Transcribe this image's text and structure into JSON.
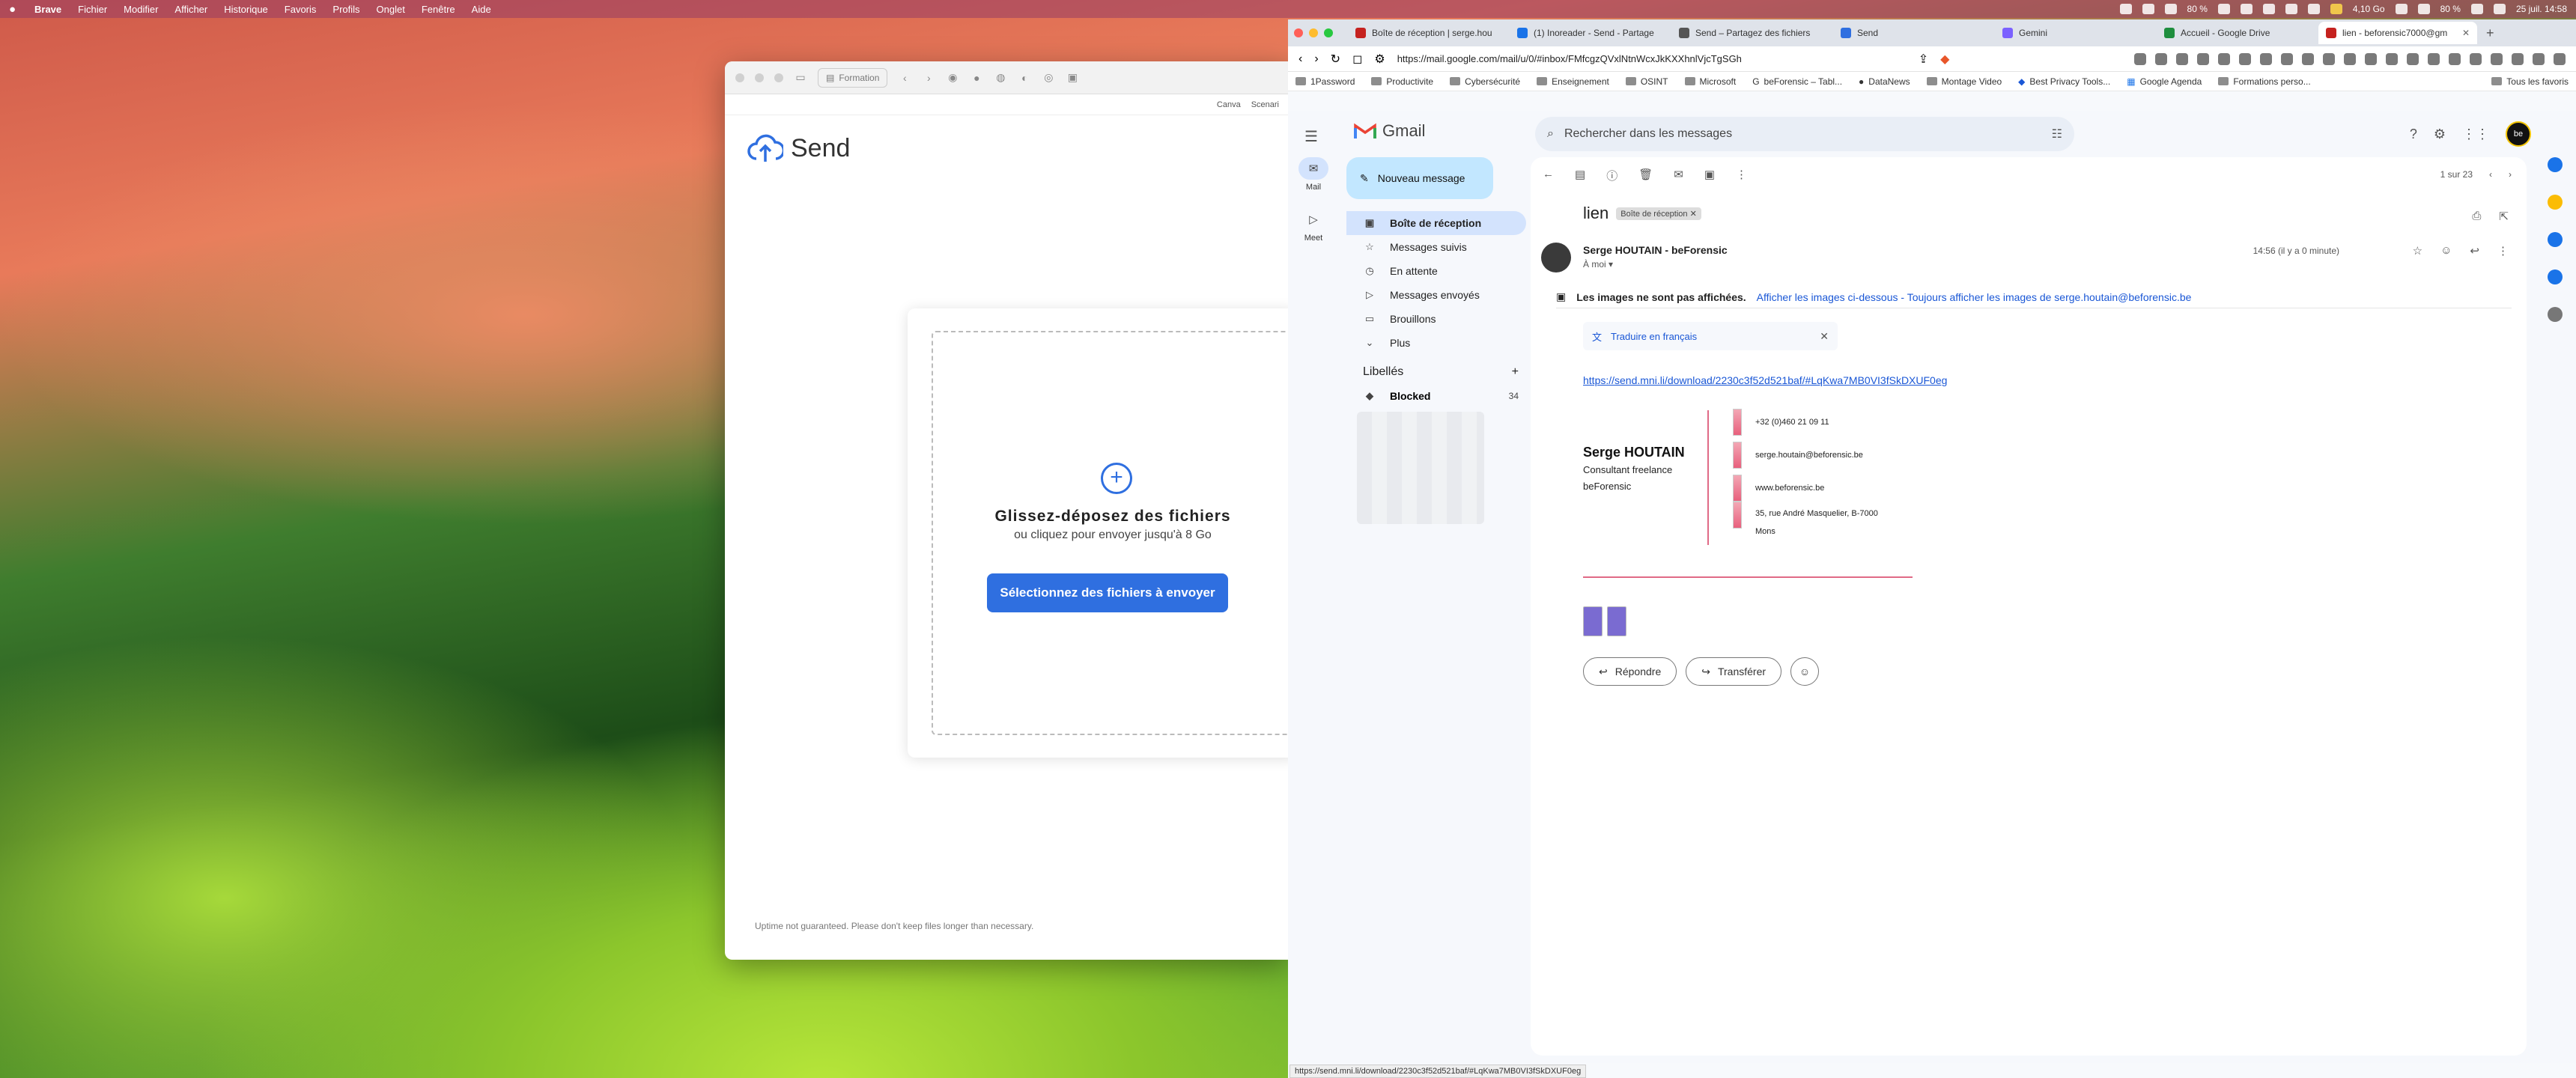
{
  "menubar": {
    "app": "Brave",
    "items": [
      "Fichier",
      "Modifier",
      "Afficher",
      "Historique",
      "Favoris",
      "Profils",
      "Onglet",
      "Fenêtre",
      "Aide"
    ],
    "battery": "80 %",
    "storage": "4,10 Go",
    "battery2": "80 %",
    "datetime": "25 juil. 14:58"
  },
  "send_window": {
    "toolbar_pill": "Formation",
    "bookmarks": [
      "Canva",
      "Scenari"
    ],
    "logo_text": "Send",
    "drop_title": "Glissez-déposez des fichiers",
    "drop_sub": "ou cliquez pour envoyer jusqu'à 8 Go",
    "select_button": "Sélectionnez des fichiers à envoyer",
    "uptime": "Uptime not guaranteed. Please don't keep files longer than necessary."
  },
  "browser": {
    "tabs": [
      {
        "label": "Boîte de réception | serge.hou",
        "color": "#c5221f"
      },
      {
        "label": "(1) Inoreader - Send - Partage",
        "color": "#1a73e8"
      },
      {
        "label": "Send – Partagez des fichiers",
        "color": "#555"
      },
      {
        "label": "Send",
        "color": "#2f6fe0"
      },
      {
        "label": "Gemini",
        "color": "#7b61ff"
      },
      {
        "label": "Accueil - Google Drive",
        "color": "#1e8e3e"
      },
      {
        "label": "lien - beforensic7000@gm",
        "color": "#c5221f"
      }
    ],
    "url": "https://mail.google.com/mail/u/0/#inbox/FMfcgzQVxlNtnWcxJkKXXhnlVjcTgSGh",
    "bookmarks": [
      "1Password",
      "Productivite",
      "Cybersécurité",
      "Enseignement",
      "OSINT",
      "Microsoft",
      "beForensic – Tabl...",
      "DataNews",
      "Montage Video",
      "Best Privacy Tools...",
      "Google Agenda",
      "Formations perso..."
    ],
    "bookmarks_all": "Tous les favoris"
  },
  "gmail": {
    "logo": "Gmail",
    "search_placeholder": "Rechercher dans les messages",
    "rail": [
      {
        "label": "Mail"
      },
      {
        "label": "Meet"
      }
    ],
    "compose": "Nouveau message",
    "nav": [
      {
        "label": "Boîte de réception",
        "icon": "inbox-icon"
      },
      {
        "label": "Messages suivis",
        "icon": "star-icon"
      },
      {
        "label": "En attente",
        "icon": "clock-icon"
      },
      {
        "label": "Messages envoyés",
        "icon": "send-icon"
      },
      {
        "label": "Brouillons",
        "icon": "draft-icon"
      },
      {
        "label": "Plus",
        "icon": "chevron-down-icon"
      }
    ],
    "labels_title": "Libellés",
    "label_blocked": "Blocked",
    "label_blocked_count": "34",
    "pager": "1 sur 23",
    "subject": "lien",
    "inbox_chip": "Boîte de réception",
    "sender": "Serge HOUTAIN - beForensic",
    "to": "À moi",
    "time": "14:56 (il y a 0 minute)",
    "images_notice": "Les images ne sont pas affichées.",
    "images_show": "Afficher les images ci-dessous",
    "images_always": "Toujours afficher les images de serge.houtain@beforensic.be",
    "translate": "Traduire en français",
    "link": "https://send.mni.li/download/2230c3f52d521baf/#LqKwa7MB0VI3fSkDXUF0eg",
    "signature": {
      "name": "Serge HOUTAIN",
      "role": "Consultant freelance",
      "company": "beForensic",
      "phone": "+32 (0)460 21 09 11",
      "email": "serge.houtain@beforensic.be",
      "web": "www.beforensic.be",
      "address1": "35, rue André Masquelier, B-7000",
      "address2": "Mons"
    },
    "reply": "Répondre",
    "forward": "Transférer"
  },
  "status_url": "https://send.mni.li/download/2230c3f52d521baf/#LqKwa7MB0VI3fSkDXUF0eg"
}
